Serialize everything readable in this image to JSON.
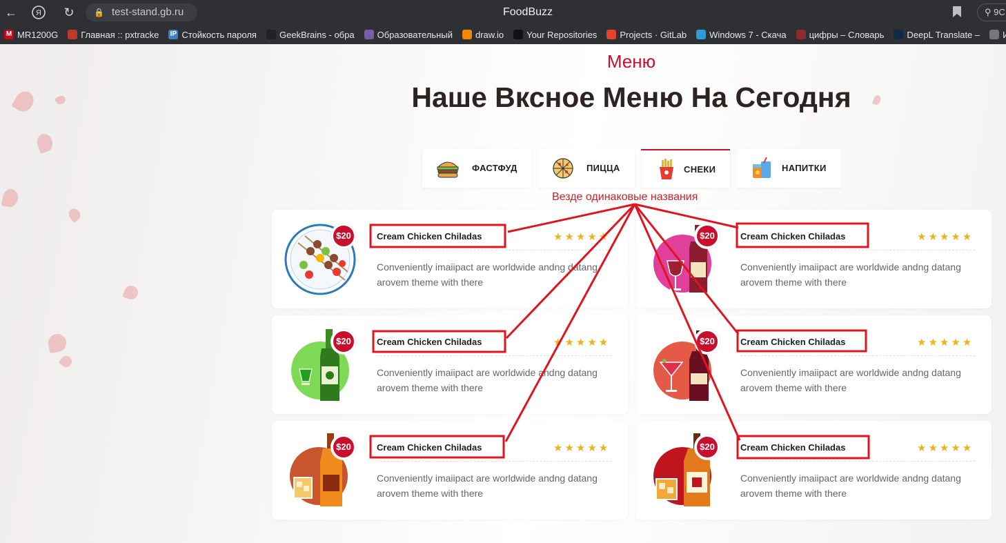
{
  "browser": {
    "address": "test-stand.gb.ru",
    "window_title": "FoodBuzz",
    "search_hint": "9C"
  },
  "bookmarks": [
    {
      "label": "MR1200G",
      "color": "#d0021b",
      "glyph": "M"
    },
    {
      "label": "Главная :: pxtracke",
      "color": "#c0392b",
      "glyph": ""
    },
    {
      "label": "Стойкость пароля",
      "color": "#3b82c4",
      "glyph": "IP"
    },
    {
      "label": "GeekBrains - обра",
      "color": "#222222",
      "glyph": ""
    },
    {
      "label": "Образовательный",
      "color": "#7a5ca8",
      "glyph": ""
    },
    {
      "label": "draw.io",
      "color": "#f08705",
      "glyph": ""
    },
    {
      "label": "Your Repositories",
      "color": "#111111",
      "glyph": ""
    },
    {
      "label": "Projects · GitLab",
      "color": "#e24329",
      "glyph": ""
    },
    {
      "label": "Windows 7 - Скача",
      "color": "#2d9bd8",
      "glyph": ""
    },
    {
      "label": "цифры – Словарь",
      "color": "#8e2c2c",
      "glyph": ""
    },
    {
      "label": "DeepL Translate –",
      "color": "#0f2b46",
      "glyph": ""
    },
    {
      "label": "Инф",
      "color": "#777777",
      "glyph": ""
    }
  ],
  "section": {
    "eyebrow": "Меню",
    "heading": "Наше Вксное Меню На Сегодня"
  },
  "tabs": [
    {
      "label": "ФАСТФУД",
      "icon": "burger-icon",
      "active": false
    },
    {
      "label": "ПИЦЦА",
      "icon": "pizza-icon",
      "active": false
    },
    {
      "label": "СНЕКИ",
      "icon": "fries-icon",
      "active": true
    },
    {
      "label": "НАПИТКИ",
      "icon": "drinks-icon",
      "active": false
    }
  ],
  "annotation": "Везде одинаковые названия",
  "menu_items": [
    {
      "price": "$20",
      "name": "Cream Chicken Chiladas",
      "rating": 5,
      "description": "Conveniently imaiipact are worldwide andng datang arovem theme with there",
      "image": "kebab-plate"
    },
    {
      "price": "$20",
      "name": "Cream Chicken Chiladas",
      "rating": 5,
      "description": "Conveniently imaiipact are worldwide andng datang arovem theme with there",
      "image": "wine-bottle-pink"
    },
    {
      "price": "$20",
      "name": "Cream Chicken Chiladas",
      "rating": 5,
      "description": "Conveniently imaiipact are worldwide andng datang arovem theme with there",
      "image": "green-bottle"
    },
    {
      "price": "$20",
      "name": "Cream Chicken Chiladas",
      "rating": 5,
      "description": "Conveniently imaiipact are worldwide andng datang arovem theme with there",
      "image": "cocktail-bottle"
    },
    {
      "price": "$20",
      "name": "Cream Chicken Chiladas",
      "rating": 5,
      "description": "Conveniently imaiipact are worldwide andng datang arovem theme with there",
      "image": "orange-bottle"
    },
    {
      "price": "$20",
      "name": "Cream Chicken Chiladas",
      "rating": 5,
      "description": "Conveniently imaiipact are worldwide andng datang arovem theme with there",
      "image": "whiskey-bottle"
    }
  ],
  "colors": {
    "accent": "#c8102e",
    "stars": "#f2b01e",
    "annotation": "#e0141e"
  }
}
